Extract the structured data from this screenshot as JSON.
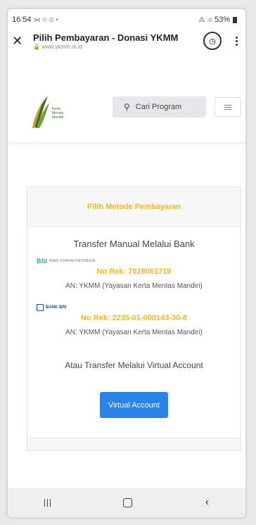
{
  "status_bar": {
    "time": "16:54",
    "left_icons": "⋈ ⟐ ⊙ •",
    "right_icons": "⁂ .ıl",
    "battery": "53%"
  },
  "browser": {
    "title": "Pilih Pembayaran - Donasi YKMM",
    "url": "www.ykmm.or.id",
    "close_icon": "close-icon",
    "history_icon": "clock-icon",
    "menu_icon": "more-vert-icon"
  },
  "header": {
    "logo_text_1": "Kerta",
    "logo_text_2": "Mentas",
    "logo_text_3": "Mandiri",
    "search_placeholder": "Cari Program"
  },
  "payment": {
    "heading": "Pilih Metode Pembayaran",
    "manual_title": "Transfer Manual Melalui Bank",
    "banks": [
      {
        "logo": "BSI",
        "logo_sub": "BANK SYARIAH INDONESIA",
        "account": "No Rek: 7028061719",
        "holder": "AN: YKMM (Yayasan Kerta Mentas Mandiri)"
      },
      {
        "logo": "BANK BRI",
        "account": "No Rek: 2235-01-000143-30-8",
        "holder": "AN: YKMM (Yayasan Kerta Mentas Mandiri)"
      }
    ],
    "va_title": "Atau Transfer Melalui Virtual Account",
    "va_button": "Virtual Account"
  },
  "colors": {
    "accent": "#f5b719",
    "button": "#2a83e6",
    "brand_green": "#3a6d2a"
  }
}
